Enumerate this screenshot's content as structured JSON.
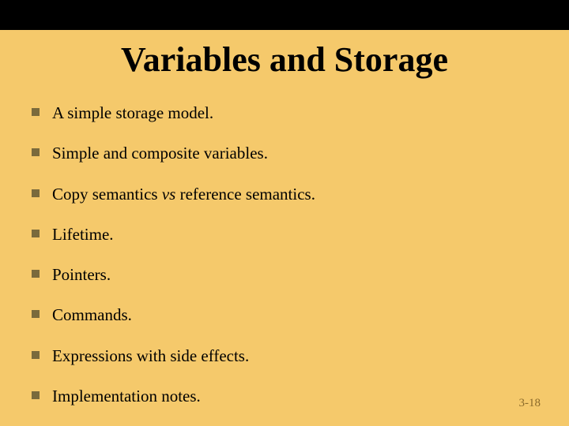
{
  "title": "Variables and Storage",
  "bullets": [
    {
      "pre": "A simple storage model.",
      "it": "",
      "post": ""
    },
    {
      "pre": "Simple and composite variables.",
      "it": "",
      "post": ""
    },
    {
      "pre": "Copy semantics ",
      "it": "vs",
      "post": " reference semantics."
    },
    {
      "pre": "Lifetime.",
      "it": "",
      "post": ""
    },
    {
      "pre": "Pointers.",
      "it": "",
      "post": ""
    },
    {
      "pre": "Commands.",
      "it": "",
      "post": ""
    },
    {
      "pre": "Expressions with side effects.",
      "it": "",
      "post": ""
    },
    {
      "pre": "Implementation notes.",
      "it": "",
      "post": ""
    }
  ],
  "page_number": "3-18"
}
